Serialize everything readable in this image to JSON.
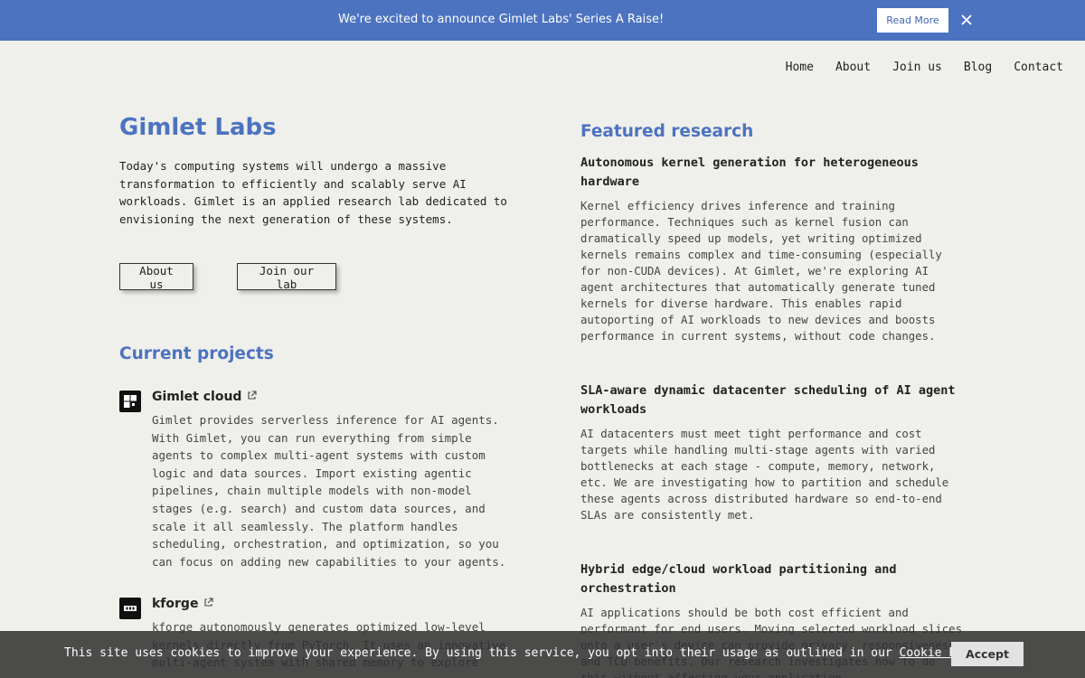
{
  "banner": {
    "text": "We're excited to announce Gimlet Labs' Series A Raise!",
    "button": "Read More",
    "close_icon": "close-icon"
  },
  "nav": [
    "Home",
    "About",
    "Join us",
    "Blog",
    "Contact"
  ],
  "hero": {
    "title": "Gimlet Labs",
    "intro": "Today's computing systems will undergo a massive transformation to efficiently and scalably serve AI workloads. Gimlet is an applied research lab dedicated to envisioning the next generation of these systems.",
    "about_button": "About us",
    "join_button": "Join our lab"
  },
  "projects": {
    "heading": "Current projects",
    "items": [
      {
        "name": "Gimlet cloud",
        "icon": "gimlet-logo-icon",
        "description": "Gimlet provides serverless inference for AI agents. With Gimlet, you can run everything from simple agents to complex multi-agent systems with custom logic and data sources. Import existing agentic pipelines, chain multiple models with non-model stages (e.g. search) and custom data sources, and scale it all seamlessly. The platform handles scheduling, orchestration, and optimization, so you can focus on adding new capabilities to your agents."
      },
      {
        "name": "kforge",
        "icon": "kforge-logo-icon",
        "description": "kforge autonomously generates optimized low-level kernels directly from PyTorch. It uses an innovative multi-agent system with shared memory to explore"
      }
    ]
  },
  "research": {
    "heading": "Featured research",
    "items": [
      {
        "title": "Autonomous kernel generation for heterogeneous hardware",
        "description": "Kernel efficiency drives inference and training performance. Techniques such as kernel fusion can dramatically speed up models, yet writing optimized kernels remains complex and time-consuming (especially for non-CUDA devices). At Gimlet, we're exploring AI agent architectures that automatically generate tuned kernels for diverse hardware. This enables rapid autoporting of AI workloads to new devices and boosts performance in current systems, without code changes."
      },
      {
        "title": "SLA-aware dynamic datacenter scheduling of AI agent workloads",
        "description": "AI datacenters must meet tight performance and cost targets while handling multi-stage agents with varied bottlenecks at each stage - compute, memory, network, etc. We are investigating how to partition and schedule these agents across distributed hardware so end-to-end SLAs are consistently met."
      },
      {
        "title": "Hybrid edge/cloud workload partitioning and orchestration",
        "description": "AI applications should be both cost efficient and performant for end users. Moving selected workload slices onto a user's device can provide privacy, responsiveness, and TCO benefits. Our research investigates how to do this without affecting your application."
      }
    ]
  },
  "cookie": {
    "text_before": "This site uses cookies to improve your experience. By using this service, you opt into their usage as outlined in our ",
    "link": "Cookie Policy",
    "text_after": ".",
    "accept": "Accept"
  },
  "colors": {
    "accent": "#4c73c0",
    "background": "#efefeb",
    "cookie_bar": "#303030"
  }
}
